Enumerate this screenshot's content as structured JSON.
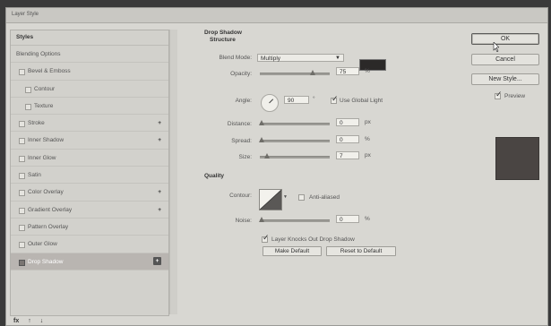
{
  "window": {
    "title": "Layer Style"
  },
  "styles_panel": {
    "header": "Styles",
    "items": [
      {
        "label": "Blending Options",
        "type": "plain",
        "checked": false,
        "plus": false
      },
      {
        "label": "Bevel & Emboss",
        "type": "check",
        "checked": false,
        "plus": false
      },
      {
        "label": "Contour",
        "type": "indent",
        "checked": false,
        "plus": false
      },
      {
        "label": "Texture",
        "type": "indent",
        "checked": false,
        "plus": false
      },
      {
        "label": "Stroke",
        "type": "check",
        "checked": false,
        "plus": true
      },
      {
        "label": "Inner Shadow",
        "type": "check",
        "checked": false,
        "plus": true
      },
      {
        "label": "Inner Glow",
        "type": "check",
        "checked": false,
        "plus": false
      },
      {
        "label": "Satin",
        "type": "check",
        "checked": false,
        "plus": false
      },
      {
        "label": "Color Overlay",
        "type": "check",
        "checked": false,
        "plus": true
      },
      {
        "label": "Gradient Overlay",
        "type": "check",
        "checked": false,
        "plus": true
      },
      {
        "label": "Pattern Overlay",
        "type": "check",
        "checked": false,
        "plus": false
      },
      {
        "label": "Outer Glow",
        "type": "check",
        "checked": false,
        "plus": false
      },
      {
        "label": "Drop Shadow",
        "type": "check",
        "checked": true,
        "plus": true,
        "selected": true
      }
    ],
    "bottom_tools": [
      "fx",
      "↑",
      "↓"
    ]
  },
  "drop_shadow": {
    "title": "Drop Shadow",
    "structure_title": "Structure",
    "blend_mode_label": "Blend Mode:",
    "blend_mode_value": "Multiply",
    "shadow_color": "#2b2928",
    "opacity_label": "Opacity:",
    "opacity_value": "75",
    "opacity_level": 0.75,
    "opacity_unit": "%",
    "angle_label": "Angle:",
    "angle_value": "90",
    "use_global_light_label": "Use Global Light",
    "use_global_light": true,
    "distance_label": "Distance:",
    "distance_value": "0",
    "distance_unit": "px",
    "spread_label": "Spread:",
    "spread_value": "0",
    "spread_unit": "%",
    "size_label": "Size:",
    "size_value": "7",
    "size_unit": "px",
    "quality_title": "Quality",
    "contour_label": "Contour:",
    "anti_aliased_label": "Anti-aliased",
    "anti_aliased": false,
    "noise_label": "Noise:",
    "noise_value": "0",
    "noise_unit": "%",
    "knockout_label": "Layer Knocks Out Drop Shadow",
    "knockout": true,
    "make_default_label": "Make Default",
    "reset_default_label": "Reset to Default"
  },
  "right_panel": {
    "ok_label": "OK",
    "cancel_label": "Cancel",
    "new_style_label": "New Style...",
    "preview_label": "Preview",
    "preview_checked": true,
    "preview_color": "#4a4543"
  }
}
